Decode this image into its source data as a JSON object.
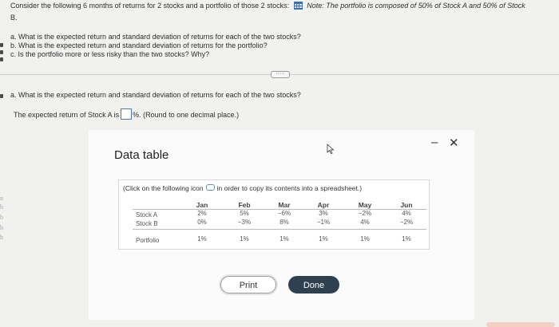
{
  "question": {
    "intro_line1": "Consider the following 6 months of returns for 2 stocks and a portfolio of those 2 stocks:",
    "note": "Note: The portfolio is composed of 50% of Stock A and 50% of Stock",
    "intro_line2": "B.",
    "part_a": "a. What is the expected return and standard deviation of returns for each of the two stocks?",
    "part_b": "b. What is the expected return and standard deviation of returns for the portfolio?",
    "part_c": "c. Is the portfolio more or less risky than the two stocks? Why?",
    "expand_label": "·····",
    "sub_a": "a. What is the expected return and standard deviation of returns for each of the two stocks?",
    "answer_prefix": "The expected return of Stock A is",
    "answer_suffix": "%. (Round to one decimal place.)"
  },
  "side_chars": [
    "n",
    "b",
    "b",
    "b",
    "h"
  ],
  "modal": {
    "title": "Data table",
    "minimize": "–",
    "close": "✕",
    "copy_note_prefix": "(Click on the following icon",
    "copy_note_suffix": "in order to copy its contents into a spreadsheet.)",
    "print_label": "Print",
    "done_label": "Done"
  },
  "table": {
    "columns": [
      "Jan",
      "Feb",
      "Mar",
      "Apr",
      "May",
      "Jun"
    ],
    "rows": [
      {
        "label": "Stock A",
        "values": [
          "2%",
          "5%",
          "−6%",
          "3%",
          "−2%",
          "4%"
        ]
      },
      {
        "label": "Stock B",
        "values": [
          "0%",
          "−3%",
          "8%",
          "−1%",
          "4%",
          "−2%"
        ]
      },
      {
        "label": "Portfolio",
        "values": [
          "1%",
          "1%",
          "1%",
          "1%",
          "1%",
          "1%"
        ]
      }
    ]
  },
  "colors": {
    "accent_blue": "#4e79c0",
    "done_button": "#2f4050",
    "background": "#f1f1ef"
  }
}
